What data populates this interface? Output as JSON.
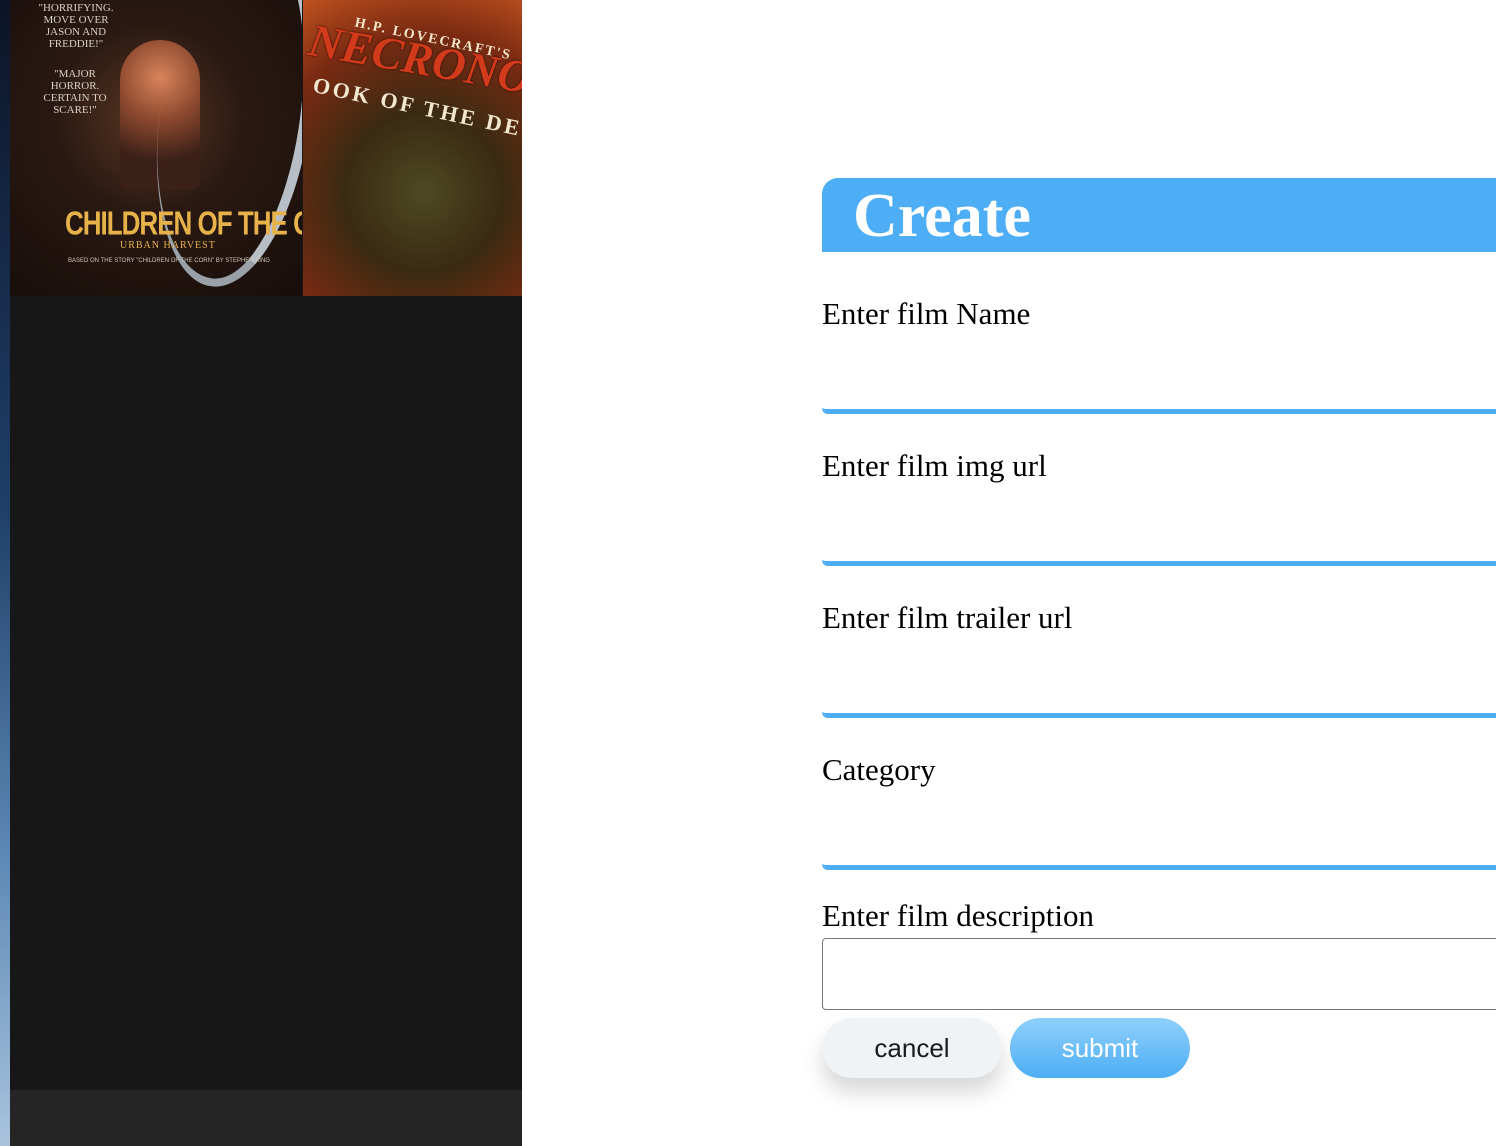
{
  "posters": {
    "left": {
      "title": "CHILDREN OF THE CORN III",
      "subtitle": "URBAN HARVEST",
      "quote_top": "\"HORRIFYING. MOVE OVER JASON AND FREDDIE!\"",
      "quote_mid": "\"MAJOR HORROR. CERTAIN TO SCARE!\"",
      "credit": "BASED ON THE STORY \"CHILDREN OF THE CORN\" BY STEPHEN KING"
    },
    "right": {
      "top_text": "H.P. LOVECRAFT'S",
      "title": "NECRONOMIC",
      "subtitle": "OOK OF THE DE"
    }
  },
  "form": {
    "title": "Create",
    "fields": [
      {
        "label": "Enter film Name",
        "value": ""
      },
      {
        "label": "Enter film img url",
        "value": ""
      },
      {
        "label": "Enter film trailer url",
        "value": ""
      },
      {
        "label": "Category",
        "value": ""
      }
    ],
    "description": {
      "label": "Enter film description",
      "value": ""
    },
    "buttons": {
      "cancel": "cancel",
      "submit": "submit"
    }
  },
  "colors": {
    "accent": "#4daef5",
    "left_panel": "#171717",
    "left_footer": "#252525",
    "cancel_bg": "#f0f3f6"
  }
}
